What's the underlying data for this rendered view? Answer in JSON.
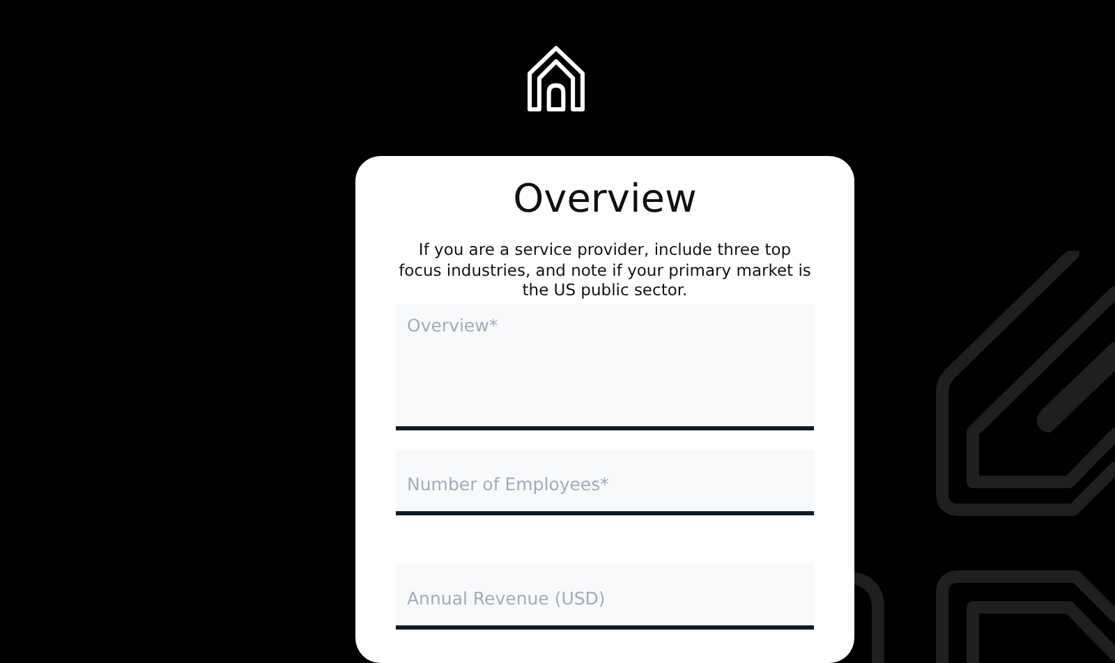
{
  "form": {
    "title": "Overview",
    "description": "If you are a service provider, include three top focus industries, and note if your primary market is the US public sector.",
    "fields": [
      {
        "kind": "textarea",
        "placeholder": "Overview*"
      },
      {
        "kind": "input",
        "placeholder": "Number of Employees*"
      },
      {
        "kind": "input",
        "placeholder": "Annual Revenue (USD)"
      }
    ]
  }
}
